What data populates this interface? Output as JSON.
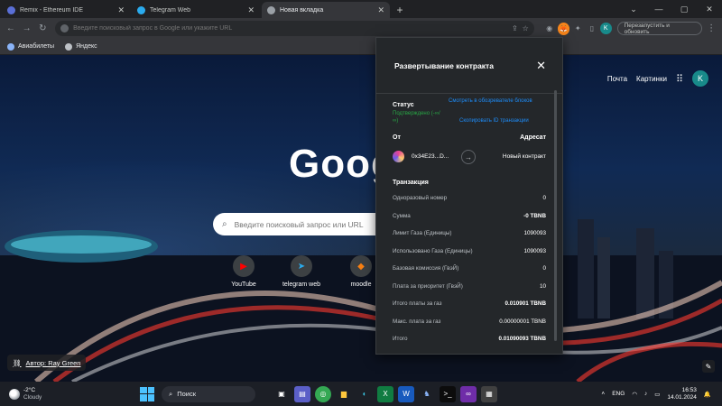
{
  "tabs": [
    {
      "title": "Remix - Ethereum IDE",
      "favicon_color": "#5a6fd6",
      "active": false
    },
    {
      "title": "Telegram Web",
      "favicon_color": "#2aabee",
      "active": false
    },
    {
      "title": "Новая вкладка",
      "favicon_color": "#9aa0a6",
      "active": true
    }
  ],
  "toolbar": {
    "omnibox_placeholder": "Введите поисковый запрос в Google или укажите URL",
    "profile_initial": "K",
    "relaunch_label": "Перезапустить и обновить"
  },
  "bookmarks": [
    {
      "label": "Авиабилеты"
    },
    {
      "label": "Яндекс"
    }
  ],
  "google": {
    "links": [
      "Почта",
      "Картинки"
    ],
    "avatar_initial": "K",
    "logo_text": "Google",
    "search_placeholder": "Введите поисковый запрос или URL",
    "shortcuts": [
      {
        "label": "YouTube",
        "icon": "youtube-icon",
        "color": "#ff0000"
      },
      {
        "label": "telegram web",
        "icon": "telegram-icon",
        "color": "#2aabee"
      },
      {
        "label": "moodle",
        "icon": "moodle-icon",
        "color": "#f98012"
      }
    ],
    "author_label": "Автор: Ray Green"
  },
  "popup": {
    "title": "Развертывание контракта",
    "status_label": "Статус",
    "status_value": "Подтверждено (-∞/∞)",
    "explorer_link": "Смотреть в обозревателе блоков",
    "copy_tx_link": "Скопировать ID транзакции",
    "from_label": "От",
    "to_label": "Адресат",
    "from_address": "0x34E23...D...",
    "to_value": "Новый контракт",
    "tx_title": "Транзакция",
    "rows": [
      {
        "label": "Одноразовый номер",
        "value": "0",
        "bold": false
      },
      {
        "label": "Сумма",
        "value": "-0 TBNB",
        "bold": true
      },
      {
        "label": "Лимит Газа (Единицы)",
        "value": "1090093",
        "bold": false
      },
      {
        "label": "Использовано Газа (Единицы)",
        "value": "1090093",
        "bold": false
      },
      {
        "label": "Базовая комиссия (ГвэЙ)",
        "value": "0",
        "bold": false
      },
      {
        "label": "Плата за приоритет (ГвэЙ)",
        "value": "10",
        "bold": false
      },
      {
        "label": "Итого платы за газ",
        "value": "0.010901 TBNB",
        "bold": true
      },
      {
        "label": "Макс. плата за газ",
        "value": "0.00000001 TBNB",
        "bold": false
      },
      {
        "label": "Итого",
        "value": "0.01090093 TBNB",
        "bold": true
      }
    ]
  },
  "taskbar": {
    "temperature": "-2°C",
    "weather": "Cloudy",
    "search_label": "Поиск",
    "language": "ENG",
    "time": "16:53",
    "date": "14.01.2024"
  }
}
